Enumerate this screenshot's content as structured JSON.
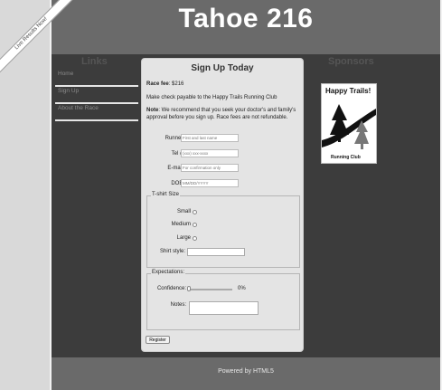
{
  "ribbon": "Live Results Now!",
  "site_title": "Tahoe 216",
  "links": {
    "title": "Links",
    "items": [
      "Home",
      "Sign Up",
      "About the Race"
    ]
  },
  "sponsors": {
    "title": "Sponsors",
    "logo_title": "Happy Trails!",
    "logo_sub": "Running Club"
  },
  "form": {
    "title": "Sign Up Today",
    "fee_label": "Race fee",
    "fee_value": ": $216",
    "check_note": "Make check payable to the Happy Trails Running Club",
    "note_label": "Note",
    "note_text": ": We recommend that you seek your doctor's and family's approval before you sign up. Race fees are not refundable.",
    "runner_label": "Runner:",
    "runner_placeholder": "First and last name",
    "tel_label": "Tel #:",
    "tel_placeholder": "(xxx) xxx-xxxx",
    "email_label": "E-mail:",
    "email_placeholder": "For confirmation only",
    "dob_label": "DOB:",
    "dob_placeholder": "MM/DD/YYYY",
    "tshirt_legend": "T-shirt Size",
    "size_small": "Small",
    "size_medium": "Medium",
    "size_large": "Large",
    "shirt_style_label": "Shirt style:",
    "expect_legend": "Expectations:",
    "confidence_label": "Confidence:",
    "confidence_value": "0%",
    "notes_label": "Notes:",
    "register_label": "Register"
  },
  "footer": "Powered by HTML5"
}
